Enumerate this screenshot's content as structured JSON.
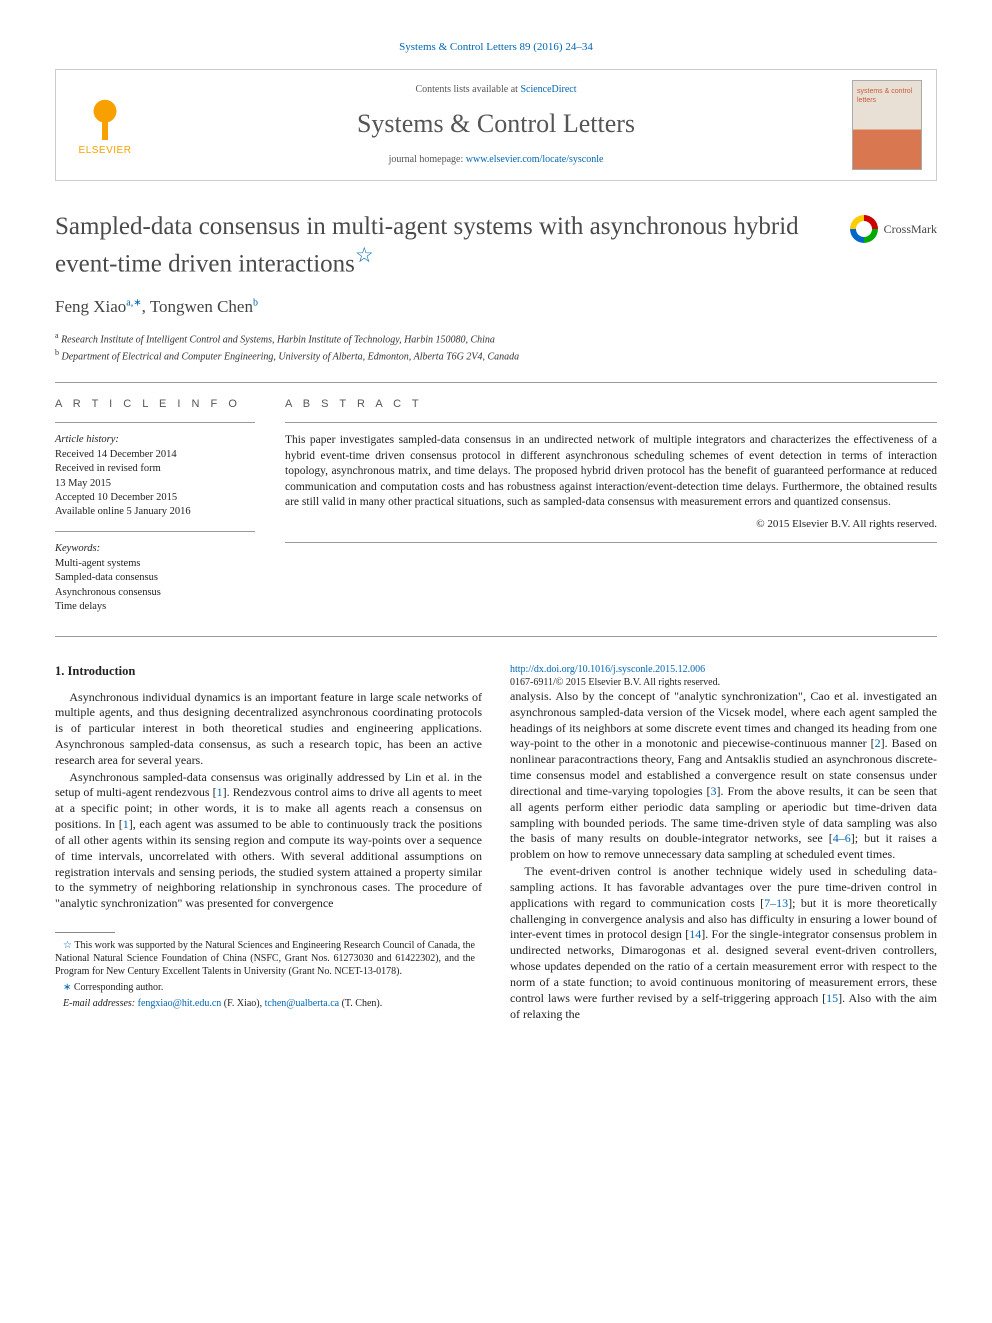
{
  "citation": "Systems & Control Letters 89 (2016) 24–34",
  "masthead": {
    "contents_prefix": "Contents lists available at ",
    "contents_link": "ScienceDirect",
    "journal": "Systems & Control Letters",
    "homepage_prefix": "journal homepage: ",
    "homepage_link": "www.elsevier.com/locate/sysconle",
    "publisher": "ELSEVIER",
    "cover_text": "systems & control letters"
  },
  "title": "Sampled-data consensus in multi-agent systems with asynchronous hybrid event-time driven interactions",
  "crossmark": "CrossMark",
  "authors_html": "Feng Xiao",
  "author1": "Feng Xiao",
  "author1_sup": "a,∗",
  "author2": "Tongwen Chen",
  "author2_sup": "b",
  "affiliations": [
    {
      "sup": "a",
      "text": "Research Institute of Intelligent Control and Systems, Harbin Institute of Technology, Harbin 150080, China"
    },
    {
      "sup": "b",
      "text": "Department of Electrical and Computer Engineering, University of Alberta, Edmonton, Alberta T6G 2V4, Canada"
    }
  ],
  "info": {
    "heading": "A R T I C L E   I N F O",
    "history_label": "Article history:",
    "history": [
      "Received 14 December 2014",
      "Received in revised form",
      "13 May 2015",
      "Accepted 10 December 2015",
      "Available online 5 January 2016"
    ],
    "keywords_label": "Keywords:",
    "keywords": [
      "Multi-agent systems",
      "Sampled-data consensus",
      "Asynchronous consensus",
      "Time delays"
    ]
  },
  "abstract": {
    "heading": "A B S T R A C T",
    "text": "This paper investigates sampled-data consensus in an undirected network of multiple integrators and characterizes the effectiveness of a hybrid event-time driven consensus protocol in different asynchronous scheduling schemes of event detection in terms of interaction topology, asynchronous matrix, and time delays. The proposed hybrid driven protocol has the benefit of guaranteed performance at reduced communication and computation costs and has robustness against interaction/event-detection time delays. Furthermore, the obtained results are still valid in many other practical situations, such as sampled-data consensus with measurement errors and quantized consensus.",
    "copyright": "© 2015 Elsevier B.V. All rights reserved."
  },
  "section1_head": "1.  Introduction",
  "paras": [
    "Asynchronous individual dynamics is an important feature in large scale networks of multiple agents, and thus designing decentralized asynchronous coordinating protocols is of particular interest in both theoretical studies and engineering applications. Asynchronous sampled-data consensus, as such a research topic, has been an active research area for several years.",
    "Asynchronous sampled-data consensus was originally addressed by Lin et al. in the setup of multi-agent rendezvous [1]. Rendezvous control aims to drive all agents to meet at a specific point; in other words, it is to make all agents reach a consensus on positions. In [1], each agent was assumed to be able to continuously track the positions of all other agents within its sensing region and compute its way-points over a sequence of time intervals, uncorrelated with others. With several additional assumptions on registration intervals and sensing periods, the studied system attained a property similar to the symmetry of neighboring relationship in synchronous cases. The procedure of \"analytic synchronization\" was presented for convergence",
    "analysis. Also by the concept of \"analytic synchronization\", Cao et al. investigated an asynchronous sampled-data version of the Vicsek model, where each agent sampled the headings of its neighbors at some discrete event times and changed its heading from one way-point to the other in a monotonic and piecewise-continuous manner [2]. Based on nonlinear paracontractions theory, Fang and Antsaklis studied an asynchronous discrete-time consensus model and established a convergence result on state consensus under directional and time-varying topologies [3]. From the above results, it can be seen that all agents perform either periodic data sampling or aperiodic but time-driven data sampling with bounded periods. The same time-driven style of data sampling was also the basis of many results on double-integrator networks, see [4–6]; but it raises a problem on how to remove unnecessary data sampling at scheduled event times.",
    "The event-driven control is another technique widely used in scheduling data-sampling actions. It has favorable advantages over the pure time-driven control in applications with regard to communication costs [7–13]; but it is more theoretically challenging in convergence analysis and also has difficulty in ensuring a lower bound of inter-event times in protocol design [14]. For the single-integrator consensus problem in undirected networks, Dimarogonas et al. designed several event-driven controllers, whose updates depended on the ratio of a certain measurement error with respect to the norm of a state function; to avoid continuous monitoring of measurement errors, these control laws were further revised by a self-triggering approach [15]. Also with the aim of relaxing the"
  ],
  "footnotes": {
    "funding_mark": "☆",
    "funding": "This work was supported by the Natural Sciences and Engineering Research Council of Canada, the National Natural Science Foundation of China (NSFC, Grant Nos. 61273030 and 61422302), and the Program for New Century Excellent Talents in University (Grant No. NCET-13-0178).",
    "corr_mark": "∗",
    "corr": "Corresponding author.",
    "email_label": "E-mail addresses:",
    "email1": "fengxiao@hit.edu.cn",
    "email1_who": "(F. Xiao),",
    "email2": "tchen@ualberta.ca",
    "email2_who": "(T. Chen)."
  },
  "doi": {
    "link": "http://dx.doi.org/10.1016/j.sysconle.2015.12.006",
    "issn_line": "0167-6911/© 2015 Elsevier B.V. All rights reserved."
  }
}
